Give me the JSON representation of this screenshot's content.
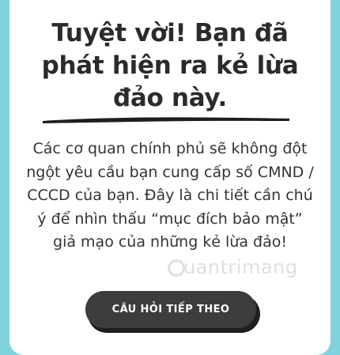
{
  "result": {
    "title": "Tuyệt vời! Bạn đã phát hiện ra kẻ lừa đảo này.",
    "message": "Các cơ quan chính phủ sẽ không đột ngột yêu cầu bạn cung cấp số CMND / CCCD của bạn. Đây là chi tiết cần chú ý để nhìn thấu “mục đích bảo mật” giả mạo của những kẻ lừa đảo!",
    "next_button_label": "CÂU HỎI TIẾP THEO"
  },
  "watermark": {
    "text": "uantrimang"
  },
  "colors": {
    "background": "#7fd3de",
    "card": "#ffffff",
    "text": "#2b2b2b",
    "button": "#3d3d3d",
    "button_text": "#ffffff"
  },
  "icons": {
    "underline": "brush-stroke-underline"
  }
}
